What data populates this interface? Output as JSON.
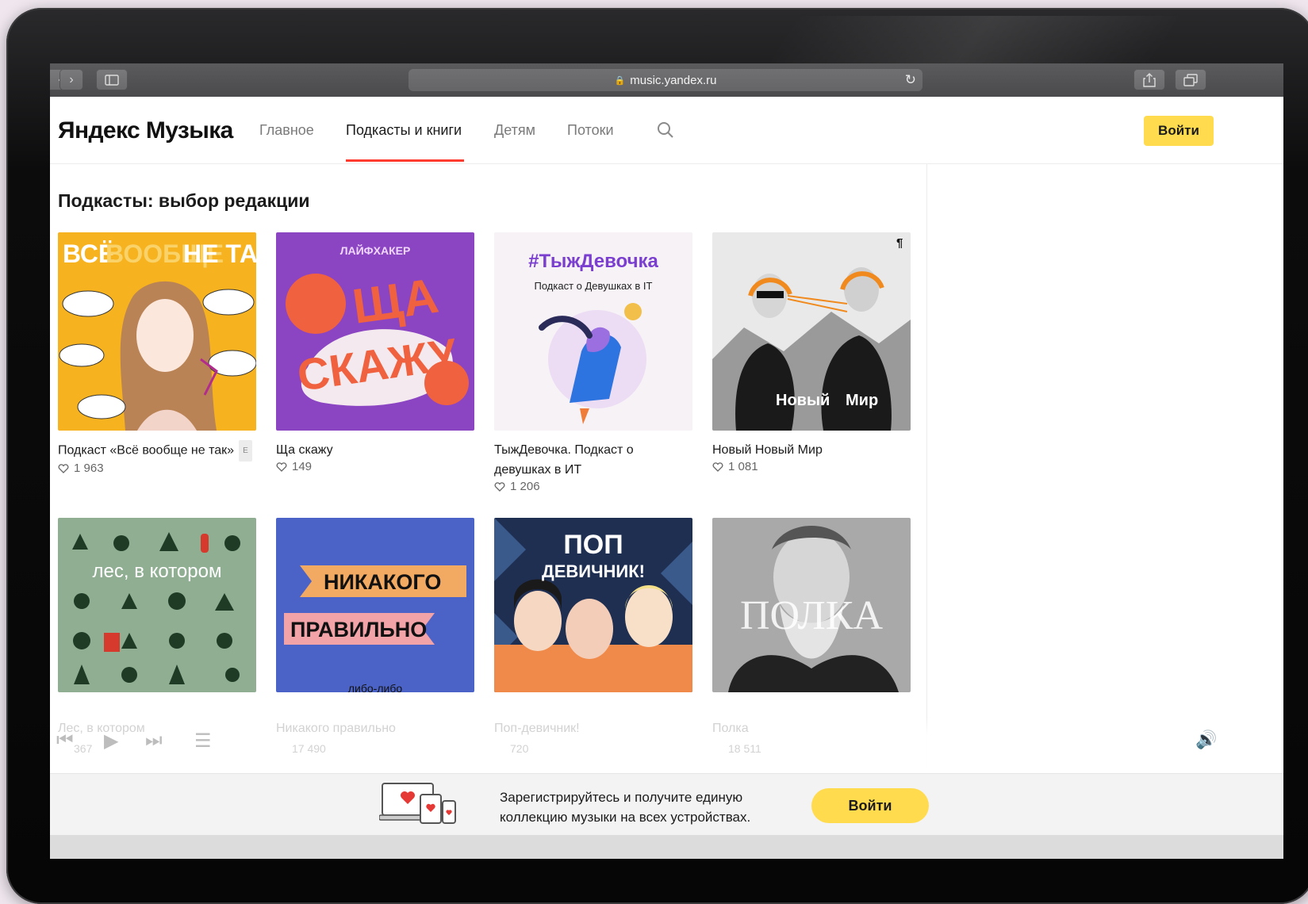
{
  "browser": {
    "url": "music.yandex.ru"
  },
  "header": {
    "logo": "Яндекс Музыка",
    "nav": [
      {
        "label": "Главное"
      },
      {
        "label": "Подкасты и книги",
        "active": true
      },
      {
        "label": "Детям"
      },
      {
        "label": "Потоки"
      }
    ],
    "login_label": "Войти"
  },
  "section": {
    "title": "Подкасты: выбор редакции"
  },
  "podcasts": [
    {
      "title": "Подкаст «Всё вообще не так»",
      "explicit": "E",
      "likes": "1 963"
    },
    {
      "title": "Ща скажу",
      "likes": "149"
    },
    {
      "title": "ТыжДевочка. Подкаст о девушках в ИТ",
      "likes": "1 206"
    },
    {
      "title": "Новый Новый Мир",
      "likes": "1 081"
    }
  ],
  "covers": [
    {
      "text_line1": "ВСЁ",
      "text_line2": "ВООБЩЕ",
      "text_line3": "НЕ ТАК"
    },
    {
      "top": "ЛАЙФХАКЕР",
      "line1": "ЩА",
      "line2": "СКАЖУ"
    },
    {
      "tag": "#ТыжДевочка",
      "sub": "Подкаст о Девушках в IT"
    },
    {
      "label1": "Новый",
      "label2": "Мир",
      "mark": "¶"
    },
    {
      "text": "лес, в котором"
    },
    {
      "line1": "НИКАКОГО",
      "line2": "ПРАВИЛЬНО",
      "bottom": "либо-либо"
    },
    {
      "line1": "ПОП",
      "line2": "ДЕВИЧНИК!"
    },
    {
      "text": "ПОЛКА"
    }
  ],
  "faded_row": {
    "titles": [
      "Лес, в котором",
      "Никакого правильно",
      "Поп-девичник!",
      "Полка"
    ],
    "likes": [
      "367",
      "17 490",
      "720",
      "18 511"
    ]
  },
  "promo": {
    "text": "Зарегистрируйтесь и получите единую коллекцию музыки на всех устройствах.",
    "button": "Войти"
  },
  "colors": {
    "accent_yellow": "#ffdb4d",
    "nav_underline": "#ff3a2f"
  }
}
